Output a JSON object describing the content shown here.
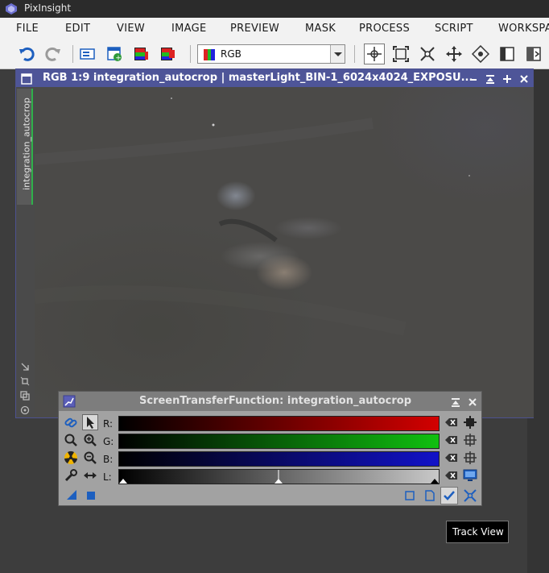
{
  "app": {
    "title": "PixInsight"
  },
  "menu": [
    "FILE",
    "EDIT",
    "VIEW",
    "IMAGE",
    "PREVIEW",
    "MASK",
    "PROCESS",
    "SCRIPT",
    "WORKSPA"
  ],
  "toolbar": {
    "colorspace_value": "RGB"
  },
  "image_window": {
    "title": "RGB 1:9 integration_autocrop | masterLight_BIN-1_6024x4024_EXPOSU...",
    "side_tab": "integration_autocrop"
  },
  "stf": {
    "title": "ScreenTransferFunction: integration_autocrop",
    "channels": [
      {
        "label": "R:",
        "color": "#d20000"
      },
      {
        "label": "G:",
        "color": "#10c010"
      },
      {
        "label": "B:",
        "color": "#1212c8"
      },
      {
        "label": "L:",
        "color": "#c8c8c8"
      }
    ]
  },
  "tooltip": "Track View",
  "colors": {
    "accent": "#4e5598",
    "menu_bg": "#f2f2f2",
    "workspace": "#3d3d3d"
  }
}
